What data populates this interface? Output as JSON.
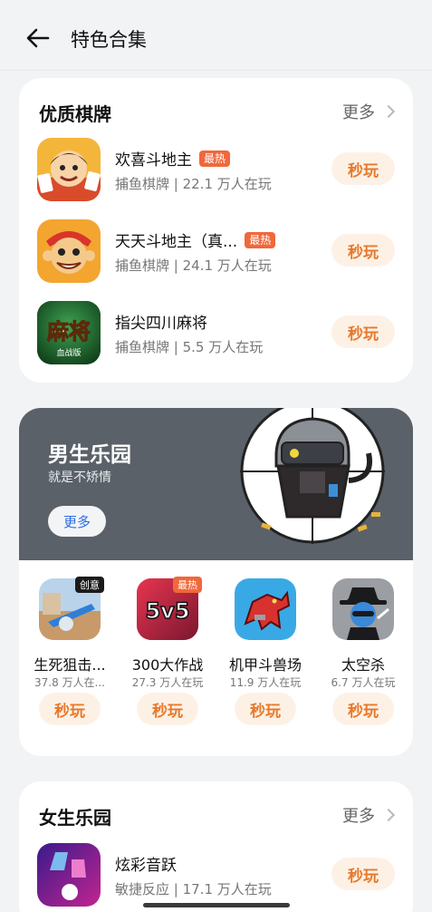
{
  "header": {
    "title": "特色合集",
    "back_icon": "back-arrow-icon"
  },
  "section1": {
    "title": "优质棋牌",
    "more": "更多",
    "items": [
      {
        "name": "欢喜斗地主",
        "badge": "最热",
        "sub": "捕鱼棋牌 | 22.1 万人在玩",
        "button": "秒玩",
        "icon": "doudizhu-character-icon"
      },
      {
        "name": "天天斗地主（真...",
        "badge": "最热",
        "sub": "捕鱼棋牌 | 24.1 万人在玩",
        "button": "秒玩",
        "icon": "monkey-character-icon"
      },
      {
        "name": "指尖四川麻将",
        "badge": "",
        "sub": "捕鱼棋牌 | 5.5 万人在玩",
        "button": "秒玩",
        "icon": "mahjong-icon",
        "icon_text": "麻将",
        "icon_subtext": "血战版"
      }
    ]
  },
  "section2": {
    "banner_title": "男生乐园",
    "banner_sub": "就是不矫情",
    "banner_more": "更多",
    "items": [
      {
        "name": "生死狙击...",
        "sub": "37.8 万人在...",
        "button": "秒玩",
        "badge": "创意",
        "icon": "sniper-game-icon"
      },
      {
        "name": "300大作战",
        "sub": "27.3 万人在玩",
        "button": "秒玩",
        "badge": "最热",
        "icon": "5v5-game-icon",
        "icon_text": "5v5"
      },
      {
        "name": "机甲斗兽场",
        "sub": "11.9 万人在玩",
        "button": "秒玩",
        "badge": "",
        "icon": "mecha-dino-icon"
      },
      {
        "name": "太空杀",
        "sub": "6.7 万人在玩",
        "button": "秒玩",
        "badge": "",
        "icon": "hat-figure-icon"
      }
    ]
  },
  "section3": {
    "title": "女生乐园",
    "more": "更多",
    "items": [
      {
        "name": "炫彩音跃",
        "sub": "敏捷反应 | 17.1 万人在玩",
        "button": "秒玩",
        "icon": "music-tiles-icon"
      }
    ]
  },
  "colors": {
    "accent": "#e8782a",
    "button_bg": "#fdf1e6",
    "hot_badge": "#f0683b",
    "banner_bg": "#5a6169",
    "link_blue": "#2d6ce0"
  }
}
